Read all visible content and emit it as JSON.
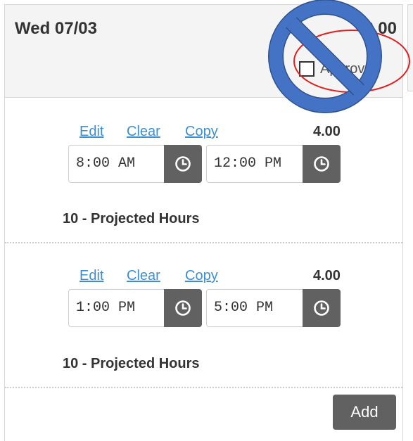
{
  "day": {
    "date": "Wed 07/03",
    "total_hours": "8.00",
    "checkbox_label": "Approve"
  },
  "entries": [
    {
      "actions": {
        "edit": "Edit",
        "clear": "Clear",
        "copy": "Copy"
      },
      "hours": "4.00",
      "start_time": "8:00 AM",
      "end_time": "12:00 PM",
      "project": "10 - Projected Hours"
    },
    {
      "actions": {
        "edit": "Edit",
        "clear": "Clear",
        "copy": "Copy"
      },
      "hours": "4.00",
      "start_time": "1:00 PM",
      "end_time": "5:00 PM",
      "project": "10 - Projected Hours"
    }
  ],
  "buttons": {
    "add": "Add"
  },
  "colors": {
    "link": "#3d8fd1",
    "clock_button": "#616161",
    "prohibit_fill": "#4472c4",
    "prohibit_outline": "#2f528f",
    "annotation_ellipse": "#e02020"
  },
  "icons": {
    "time_picker": "clock-icon",
    "overlay": "prohibited-icon"
  }
}
